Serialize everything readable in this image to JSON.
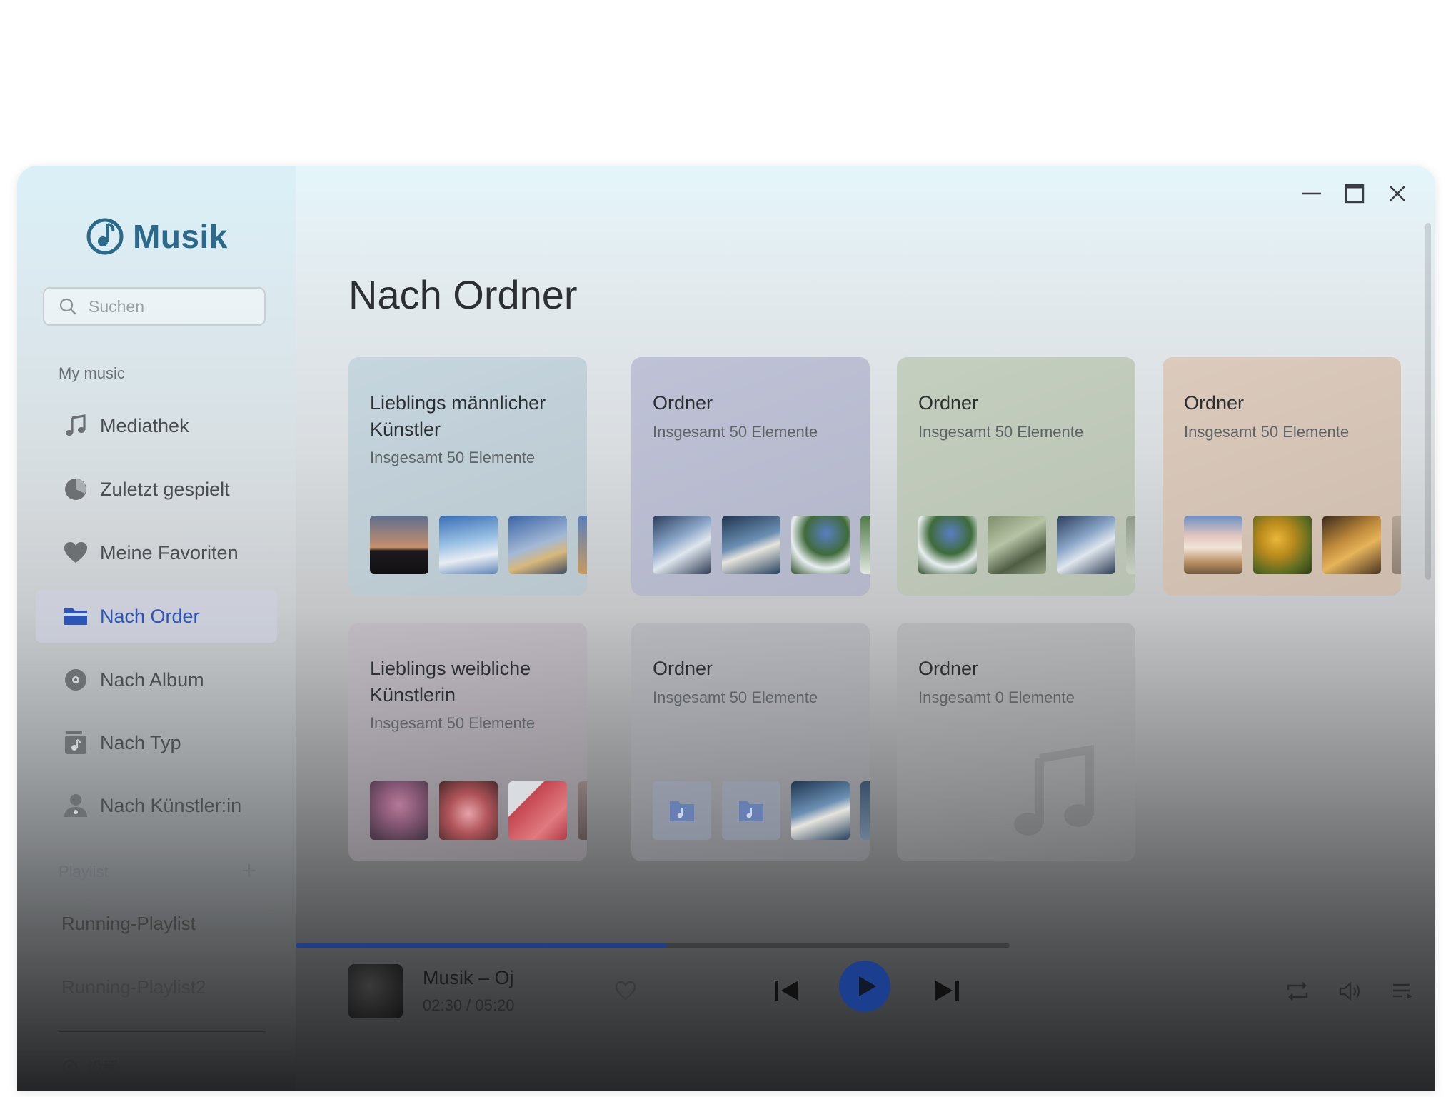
{
  "app": {
    "name": "Musik"
  },
  "search": {
    "placeholder": "Suchen"
  },
  "sidebar": {
    "section_my_music": "My music",
    "items": [
      {
        "label": "Mediathek",
        "icon": "music-note-icon"
      },
      {
        "label": "Zuletzt gespielt",
        "icon": "clock-icon"
      },
      {
        "label": "Meine Favoriten",
        "icon": "heart-icon"
      },
      {
        "label": "Nach Order",
        "icon": "folder-icon",
        "active": true
      },
      {
        "label": "Nach Album",
        "icon": "disc-icon"
      },
      {
        "label": "Nach Typ",
        "icon": "music-file-icon"
      },
      {
        "label": "Nach Künstler:in",
        "icon": "artist-icon"
      }
    ],
    "section_playlist": "Playlist",
    "playlists": [
      "Running-Playlist",
      "Running-Playlist2"
    ],
    "bottom_label": "设置"
  },
  "main": {
    "title": "Nach Ordner",
    "cards": [
      {
        "title": "Lieblings männlicher Künstler",
        "subtitle": "Insgesamt 50 Elemente"
      },
      {
        "title": "Ordner",
        "subtitle": "Insgesamt 50 Elemente"
      },
      {
        "title": "Ordner",
        "subtitle": "Insgesamt 50 Elemente"
      },
      {
        "title": "Ordner",
        "subtitle": "Insgesamt 50 Elemente"
      },
      {
        "title": "Lieblings weibliche Künstlerin",
        "subtitle": "Insgesamt 50 Elemente"
      },
      {
        "title": "Ordner",
        "subtitle": "Insgesamt 50 Elemente"
      },
      {
        "title": "Ordner",
        "subtitle": "Insgesamt 0 Elemente"
      }
    ]
  },
  "player": {
    "track_title": "Musik – Oj",
    "time": "02:30 / 05:20",
    "progress": 0.52
  },
  "colors": {
    "accent": "#2c55b5",
    "brand": "#2c6a8c",
    "play_button": "#1b3f8e"
  }
}
